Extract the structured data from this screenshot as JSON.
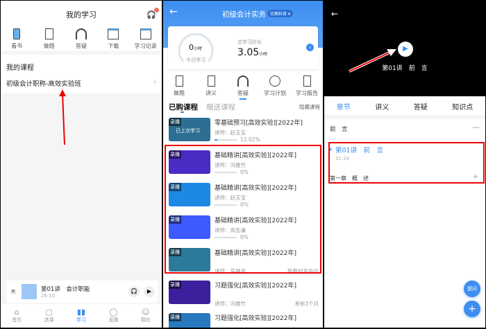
{
  "p1": {
    "title": "我的学习",
    "badge": "",
    "shortcuts": [
      {
        "icon": "book-icon",
        "label": "看书"
      },
      {
        "icon": "exercise-icon",
        "label": "做题"
      },
      {
        "icon": "headset-icon",
        "label": "答疑"
      },
      {
        "icon": "download-icon",
        "label": "下载"
      },
      {
        "icon": "calendar-icon",
        "label": "学习记录"
      }
    ],
    "section": "我的课程",
    "course": "初级会计职称-高效实验班",
    "player": {
      "title": "第01讲　会计职能",
      "time": "26:10"
    },
    "tabs": [
      "首页",
      "选课",
      "学习",
      "直播",
      "我的"
    ],
    "active_tab": 2
  },
  "p2": {
    "title": "初级会计实务",
    "switch": "切换科目",
    "today_value": "0",
    "today_unit": "小时",
    "today_label": "今日学习",
    "total_label": "总学习时长",
    "total_value": "3.05",
    "total_unit": "小时",
    "tools": [
      {
        "icon": "exercise-icon",
        "label": "做题"
      },
      {
        "icon": "note-icon",
        "label": "讲义"
      },
      {
        "icon": "headset-icon",
        "label": "答疑"
      },
      {
        "icon": "clock-icon",
        "label": "学习计划"
      },
      {
        "icon": "report-icon",
        "label": "学习报告"
      }
    ],
    "tab_bought": "已购课程",
    "tab_gift": "赠送课程",
    "hide": "隐藏课程",
    "courses": [
      {
        "title": "零基础预习[高效实验][2022年]",
        "teacher": "讲师：赵玉宝",
        "progress": "12.02%",
        "progress_value": 12.02,
        "tag": "录播",
        "thumb": "#2d6f93",
        "overlay": "已上次学习"
      },
      {
        "title": "基础精讲[高效实验][2022年]",
        "teacher": "讲师：冯雅竹",
        "progress": "0%",
        "progress_value": 0,
        "tag": "录播",
        "thumb": "#4a2bc4"
      },
      {
        "title": "基础精讲[高效实验][2022年]",
        "teacher": "讲师：赵玉宝",
        "progress": "0%",
        "progress_value": 0,
        "tag": "录播",
        "thumb": "#1e88e5"
      },
      {
        "title": "基础精讲[高效实验][2022年]",
        "teacher": "讲师：高志谦",
        "progress": "0%",
        "progress_value": 0,
        "tag": "录播",
        "thumb": "#3d5afe"
      },
      {
        "title": "基础精讲[高效实验][2022年]",
        "teacher": "讲师：吴福喜",
        "right": "新教材发布后",
        "tag": "录播",
        "thumb": "#2b7a9b"
      },
      {
        "title": "习题强化[高效实验][2022年]",
        "teacher": "讲师：冯雅竹",
        "right": "考前3个月",
        "tag": "录播",
        "thumb": "#3b1f9c"
      },
      {
        "title": "习题强化[高效实验][2022年]",
        "teacher": "",
        "tag": "录播",
        "thumb": "#2878c0"
      }
    ]
  },
  "p3": {
    "video_title": "第01讲　前　言",
    "tabs": [
      "章节",
      "讲义",
      "答疑",
      "知识点"
    ],
    "section1": "前　言",
    "lesson": "第01讲　前　言",
    "lesson_time": "31:24",
    "section2": "第一章　概　述",
    "fab_ask": "提问",
    "accent": "#3d8ef0"
  }
}
